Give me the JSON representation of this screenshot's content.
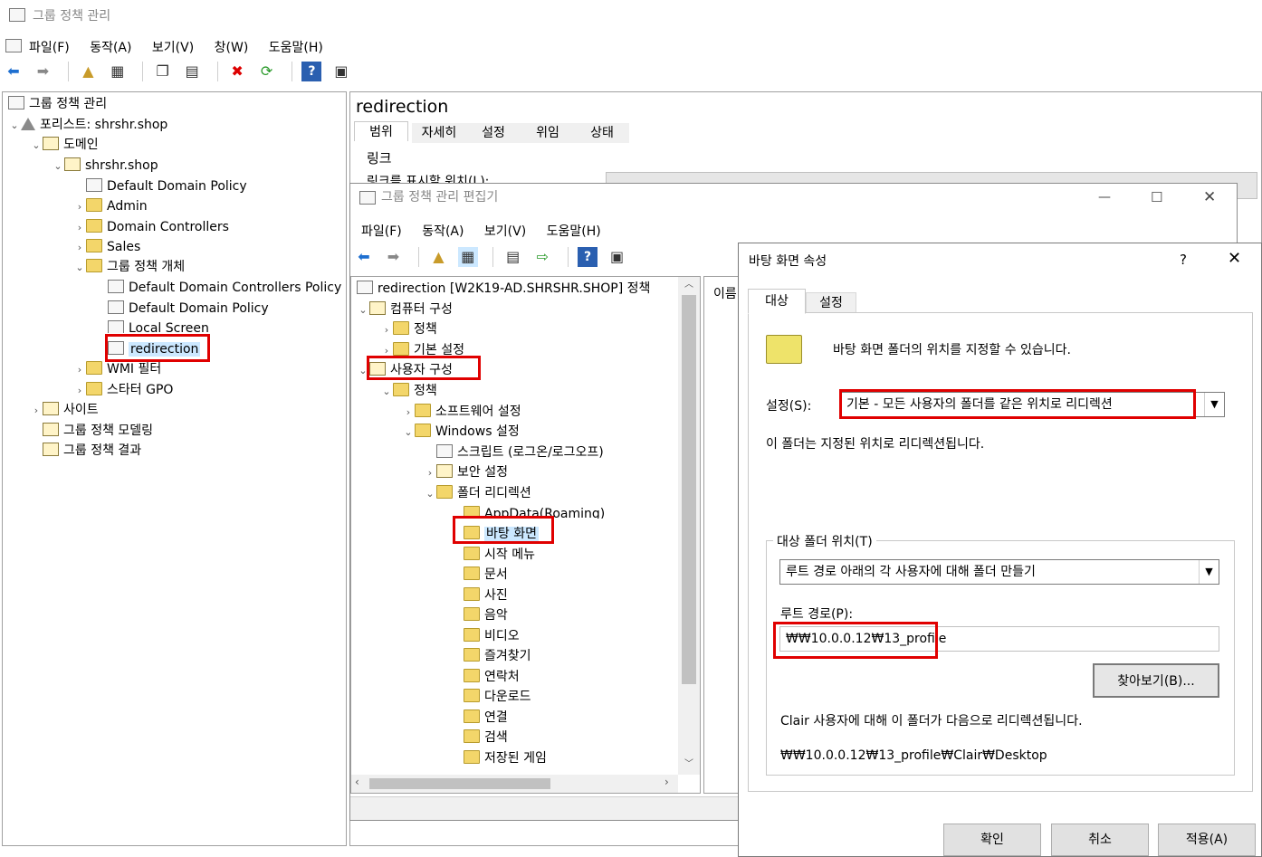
{
  "main": {
    "title": "그룹 정책 관리",
    "menu": [
      "파일(F)",
      "동작(A)",
      "보기(V)",
      "창(W)",
      "도움말(H)"
    ]
  },
  "tree": {
    "root": "그룹 정책 관리",
    "forest": "포리스트: shrshr.shop",
    "domains": "도메인",
    "domain": "shrshr.shop",
    "default_domain_policy": "Default Domain Policy",
    "admin": "Admin",
    "domain_controllers": "Domain Controllers",
    "sales": "Sales",
    "gpo_objects": "그룹 정책 개체",
    "ddcp": "Default Domain Controllers Policy",
    "ddp2": "Default Domain Policy",
    "local_screen": "Local Screen",
    "redirection": "redirection",
    "wmi": "WMI 필터",
    "starter_gpo": "스타터 GPO",
    "sites": "사이트",
    "modeling": "그룹 정책 모델링",
    "results": "그룹 정책 결과"
  },
  "right_pane": {
    "title": "redirection",
    "tabs": [
      "범위",
      "자세히",
      "설정",
      "위임",
      "상태"
    ],
    "link_heading": "링크",
    "link_location": "링크를 표시할 위치(L):"
  },
  "editor": {
    "title": "그룹 정책 관리 편집기",
    "menu": [
      "파일(F)",
      "동작(A)",
      "보기(V)",
      "도움말(H)"
    ],
    "root": "redirection [W2K19-AD.SHRSHR.SHOP] 정책",
    "computer_config": "컴퓨터 구성",
    "policies": "정책",
    "preferences": "기본 설정",
    "user_config": "사용자 구성",
    "user_policies": "정책",
    "software_settings": "소프트웨어 설정",
    "windows_settings": "Windows 설정",
    "scripts": "스크립트 (로그온/로그오프)",
    "security": "보안 설정",
    "folder_redirection": "폴더 리디렉션",
    "folders": [
      "AppData(Roaming)",
      "바탕 화면",
      "시작 메뉴",
      "문서",
      "사진",
      "음악",
      "비디오",
      "즐겨찾기",
      "연락처",
      "다운로드",
      "연결",
      "검색",
      "저장된 게임"
    ],
    "name_col": "이름"
  },
  "dialog": {
    "title": "바탕 화면 속성",
    "help": "?",
    "tabs": [
      "대상",
      "설정"
    ],
    "description": "바탕 화면 폴더의 위치를 지정할 수 있습니다.",
    "setting_label": "설정(S):",
    "setting_value": "기본 - 모든 사용자의 폴더를 같은 위치로 리디렉션",
    "setting_note": "이 폴더는 지정된 위치로 리디렉션됩니다.",
    "target_group": "대상 폴더 위치(T)",
    "target_value": "루트 경로 아래의 각 사용자에 대해 폴더 만들기",
    "root_path_label": "루트 경로(P):",
    "root_path_value": "₩₩10.0.0.12₩13_profile",
    "browse": "찾아보기(B)...",
    "example_line": "Clair 사용자에 대해 이 폴더가 다음으로 리디렉션됩니다.",
    "example_path": "₩₩10.0.0.12₩13_profile₩Clair₩Desktop",
    "ok": "확인",
    "cancel": "취소",
    "apply": "적용(A)"
  },
  "colors": {
    "highlight": "#e00000",
    "selection": "#cce8ff",
    "folder": "#f3d66a"
  }
}
